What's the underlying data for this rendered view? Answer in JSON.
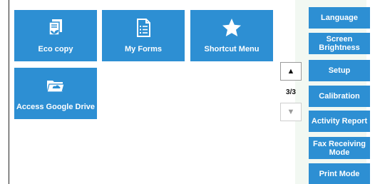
{
  "tiles": [
    {
      "label": "Eco copy",
      "icon": "eco-copy-icon"
    },
    {
      "label": "My Forms",
      "icon": "form-icon"
    },
    {
      "label": "Shortcut Menu",
      "icon": "star-icon"
    },
    {
      "label": "Access Google Drive",
      "icon": "folder-cloud-icon"
    }
  ],
  "pager": {
    "indicator": "3/3",
    "up_icon": "arrow-up-icon",
    "down_icon": "arrow-down-icon"
  },
  "side_menu": [
    {
      "label": "Language"
    },
    {
      "label_line1": "Screen",
      "label_line2": "Brightness"
    },
    {
      "label": "Setup"
    },
    {
      "label": "Calibration"
    },
    {
      "label": "Activity Report"
    },
    {
      "label_line1": "Fax Receiving",
      "label_line2": "Mode"
    },
    {
      "label": "Print Mode"
    }
  ],
  "colors": {
    "tile": "#2d8fd3",
    "panel": "#2d8fd3",
    "text": "#ffffff"
  }
}
